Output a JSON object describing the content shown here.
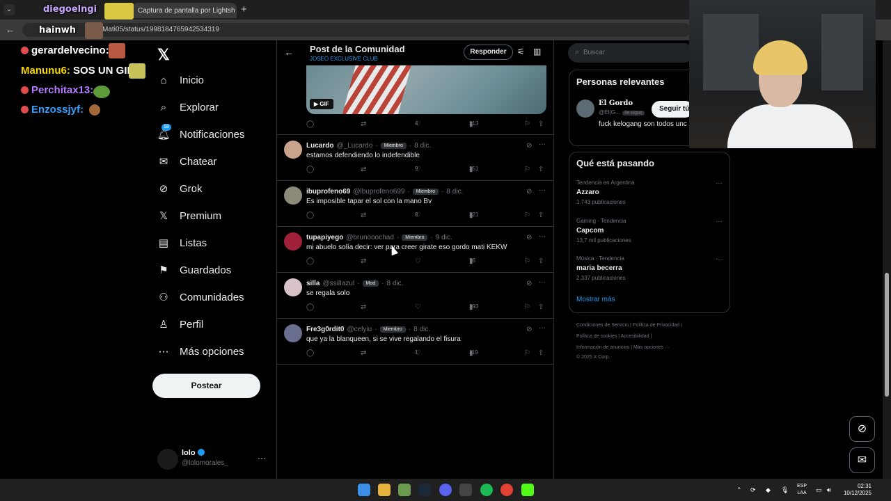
{
  "browser": {
    "tab2_title": "Captura de pantalla por Lightsh",
    "url_text": "ordoMati05/status/1998184765942534319",
    "new_tab": "+"
  },
  "overlay": {
    "streamer_name": "diegoelngi",
    "streamer_name2": "hainwh",
    "chat": [
      {
        "user": "gerardelvecino:",
        "msg": "",
        "color": "#ffffff",
        "dot": "#e04c4c"
      },
      {
        "user": "Manunu6:",
        "msg": " SOS UN GIL",
        "color": "#f5d800",
        "dot": ""
      },
      {
        "user": "Perchitax13:",
        "msg": "",
        "color": "#b57bff",
        "dot": "#e04c4c"
      },
      {
        "user": "Enzossjyf:",
        "msg": "",
        "color": "#3aa0ff",
        "dot": "#e04c4c"
      }
    ]
  },
  "nav": {
    "items": [
      {
        "label": "Inicio",
        "icon": "home-icon",
        "glyph": "⌂"
      },
      {
        "label": "Explorar",
        "icon": "search-icon",
        "glyph": "⌕"
      },
      {
        "label": "Notificaciones",
        "icon": "bell-icon",
        "glyph": "🔔︎",
        "badge": "18"
      },
      {
        "label": "Chatear",
        "icon": "mail-icon",
        "glyph": "✉"
      },
      {
        "label": "Grok",
        "icon": "grok-icon",
        "glyph": "⊘"
      },
      {
        "label": "Premium",
        "icon": "x-premium-icon",
        "glyph": "𝕏"
      },
      {
        "label": "Listas",
        "icon": "list-icon",
        "glyph": "▤"
      },
      {
        "label": "Guardados",
        "icon": "bookmark-icon",
        "glyph": "⚑"
      },
      {
        "label": "Comunidades",
        "icon": "communities-icon",
        "glyph": "⚇"
      },
      {
        "label": "Perfil",
        "icon": "person-icon",
        "glyph": "♙"
      },
      {
        "label": "Más opciones",
        "icon": "more-circle-icon",
        "glyph": "⋯"
      }
    ],
    "post_button": "Postear",
    "profile_name": "lolo",
    "profile_handle": "@lolomorales_"
  },
  "header": {
    "title": "Post de la Comunidad",
    "subtitle": "JOSEO EXCLUSIVE CLUB",
    "reply_button": "Responder"
  },
  "main_post": {
    "gif_label": "GIF",
    "likes": "4",
    "views": "313"
  },
  "replies": [
    {
      "name": "Lucardo",
      "handle": "@_Lucardo",
      "badge": "Miembro",
      "date": "8 dic.",
      "text": "estamos defendiendo lo indefendible",
      "replies": "",
      "retweets": "",
      "likes": "9",
      "views": "351",
      "avatar": "#c9a38c"
    },
    {
      "name": "ibuprofeno69",
      "handle": "@lbuprofeno699",
      "badge": "Miembro",
      "date": "8 dic.",
      "text": "Es imposible tapar el sol con la mano Bv",
      "replies": "",
      "retweets": "",
      "likes": "8",
      "views": "321",
      "avatar": "#8c8a78"
    },
    {
      "name": "tupapiyego",
      "handle": "@brunooochad",
      "badge": "Miembro",
      "date": "9 dic.",
      "text": "mi abuelo solía decir: ver para creer girate eso gordo mati KEKW",
      "replies": "",
      "retweets": "",
      "likes": "",
      "views": "76",
      "avatar": "#a0203a"
    },
    {
      "name": "silla",
      "handle": "@ssilIazul",
      "badge": "Mod",
      "date": "8 dic.",
      "text": "se regala solo",
      "replies": "",
      "retweets": "",
      "likes": "",
      "views": "293",
      "avatar": "#d8c4c8"
    },
    {
      "name": "Fre3g0rdit0",
      "handle": "@celyiu",
      "badge": "Miembro",
      "date": "8 dic.",
      "text": "que ya la blanqueen, si se vive regalando el fisura",
      "replies": "",
      "retweets": "",
      "likes": "1",
      "views": "119",
      "avatar": "#6a6f8f"
    }
  ],
  "sidebar": {
    "search_placeholder": "Buscar",
    "relevant_title": "Personas relevantes",
    "relevant_name": "El Gordo",
    "relevant_handle": "@El(G...",
    "relevant_tag": "Te sigue",
    "relevant_bio": "fuck kelogang son todos unc",
    "follow_button": "Seguir tú",
    "trends_title": "Qué está pasando",
    "trends": [
      {
        "meta": "Tendencia en Argentina",
        "name": "Azzaro",
        "count": "1.743 publicaciones"
      },
      {
        "meta": "Gaming · Tendencia",
        "name": "Capcom",
        "count": "13,7 mil publicaciones"
      },
      {
        "meta": "Música · Tendencia",
        "name": "maria becerra",
        "count": "2.337 publicaciones"
      }
    ],
    "show_more": "Mostrar más",
    "footer_1": "Condiciones de Servicio  |  Política de Privacidad  |",
    "footer_2": "Política de cookies  |  Accesibilidad  |",
    "footer_3": "Información de anuncios  |  Más opciones ···",
    "footer_4": "© 2025 X Corp."
  },
  "taskbar": {
    "lang1": "ESP",
    "lang2": "LAA",
    "time": "02:31",
    "date": "10/12/2025"
  },
  "colors": {
    "accent": "#1d9bf0",
    "bg": "#000000",
    "border": "#2f3336"
  }
}
